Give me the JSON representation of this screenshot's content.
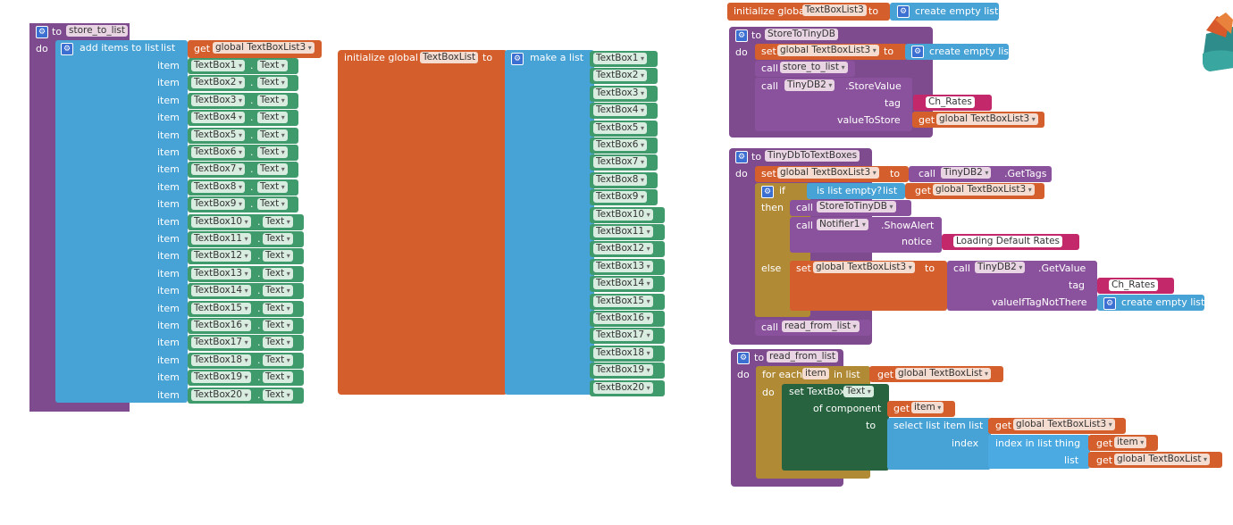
{
  "store_to_list": {
    "header": "to",
    "proc_name": "store_to_list",
    "do": "do",
    "add_items": "add items to list",
    "list_label": "list",
    "get_label": "get",
    "list_var": "global TextBoxList3",
    "item_label": "item",
    "dot": ".",
    "prop": "Text",
    "items": [
      "TextBox1",
      "TextBox2",
      "TextBox3",
      "TextBox4",
      "TextBox5",
      "TextBox6",
      "TextBox7",
      "TextBox8",
      "TextBox9",
      "TextBox10",
      "TextBox11",
      "TextBox12",
      "TextBox13",
      "TextBox14",
      "TextBox15",
      "TextBox16",
      "TextBox17",
      "TextBox18",
      "TextBox19",
      "TextBox20"
    ]
  },
  "init_textboxlist": {
    "label": "initialize global",
    "var": "TextBoxList",
    "to": "to",
    "make_list": "make a list",
    "items": [
      "TextBox1",
      "TextBox2",
      "TextBox3",
      "TextBox4",
      "TextBox5",
      "TextBox6",
      "TextBox7",
      "TextBox8",
      "TextBox9",
      "TextBox10",
      "TextBox11",
      "TextBox12",
      "TextBox13",
      "TextBox14",
      "TextBox15",
      "TextBox16",
      "TextBox17",
      "TextBox18",
      "TextBox19",
      "TextBox20"
    ]
  },
  "init_textboxlist3": {
    "label": "initialize global",
    "var": "TextBoxList3",
    "to": "to",
    "create_empty": "create empty list"
  },
  "store_to_tinydb": {
    "to": "to",
    "name": "StoreToTinyDB",
    "do": "do",
    "set": "set",
    "var": "global TextBoxList3",
    "set_to": "to",
    "create_empty": "create empty list",
    "call": "call",
    "proc": "store_to_list",
    "call2": "call",
    "component": "TinyDB2",
    "method": ".StoreValue",
    "tag_label": "tag",
    "tag_value": "Ch_Rates",
    "value_label": "valueToStore",
    "get": "get",
    "get_var": "global TextBoxList3"
  },
  "tinydb_to_textboxes": {
    "to": "to",
    "name": "TinyDbToTextBoxes",
    "do": "do",
    "set": "set",
    "var": "global TextBoxList3",
    "set_to": "to",
    "call": "call",
    "component": "TinyDB2",
    "method": ".GetTags",
    "if": "if",
    "is_empty": "is list empty?",
    "list_label": "list",
    "get": "get",
    "get_var": "global TextBoxList3",
    "then": "then",
    "call_then": "call",
    "proc_then": "StoreToTinyDB",
    "call_notifier": "call",
    "notifier": "Notifier1",
    "show_alert": ".ShowAlert",
    "notice_label": "notice",
    "notice_value": "Loading Default Rates",
    "else": "else",
    "else_set": "set",
    "else_var": "global TextBoxList3",
    "else_to": "to",
    "else_call": "call",
    "else_component": "TinyDB2",
    "get_value": ".GetValue",
    "tag_label": "tag",
    "tag_value": "Ch_Rates",
    "vitnt": "valueIfTagNotThere",
    "create_empty": "create empty list",
    "call_read": "call",
    "read_proc": "read_from_list"
  },
  "read_from_list": {
    "to": "to",
    "name": "read_from_list",
    "do": "do",
    "for_each": "for each",
    "item_var": "item",
    "in_list": "in list",
    "get": "get",
    "list_var": "global TextBoxList",
    "do_inner": "do",
    "set_tb": "set TextBox.",
    "text_prop": "Text",
    "of_component": "of component",
    "get_item": "get",
    "item_ref": "item",
    "to_label": "to",
    "select_item": "select list item  list",
    "get2": "get",
    "list_var3": "global TextBoxList3",
    "index_label": "index",
    "index_in_list": "index in list  thing",
    "get3": "get",
    "item_ref2": "item",
    "list_label": "list",
    "get4": "get",
    "list_var4": "global TextBoxList"
  }
}
